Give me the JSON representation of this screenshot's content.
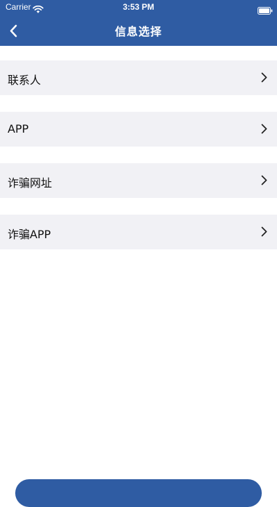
{
  "status_bar": {
    "carrier": "Carrier",
    "time": "3:53 PM"
  },
  "header": {
    "title": "信息选择",
    "background": "#2f5ca3"
  },
  "menu": {
    "items": [
      {
        "label": "联系人",
        "icon": "chevron-right-icon"
      },
      {
        "label": "APP",
        "icon": "chevron-right-icon"
      },
      {
        "label": "诈骗网址",
        "icon": "chevron-right-icon"
      },
      {
        "label": "诈骗APP",
        "icon": "chevron-right-icon"
      }
    ]
  },
  "colors": {
    "accent": "#2f5ca3",
    "row_background": "#f1f1f5",
    "page_background": "#ffffff"
  }
}
